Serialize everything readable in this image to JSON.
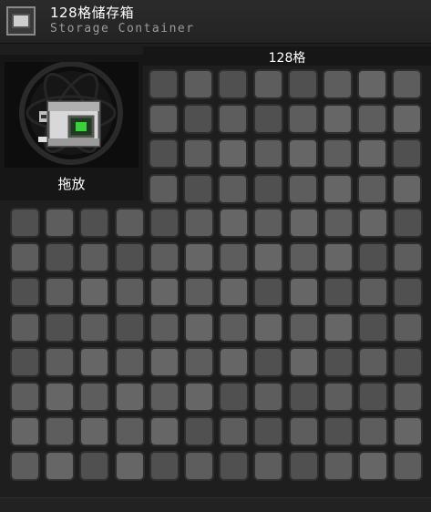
{
  "window": {
    "title": "128格储存箱",
    "subtitle": "Storage Container",
    "icon": "storage-container-icon"
  },
  "capacity": {
    "label": "128格",
    "slots": 128
  },
  "preview": {
    "label": "拖放",
    "icon": "storage-container-icon",
    "accent_color": "#3ad13a"
  },
  "grid": {
    "top_block": {
      "rows": 4,
      "cols": 8
    },
    "main_block": {
      "rows": 8,
      "cols": 12
    }
  },
  "colors": {
    "slot_fill": "#5d5d5d",
    "slot_border": "#2e2e2e",
    "background": "#1e1e1e"
  }
}
